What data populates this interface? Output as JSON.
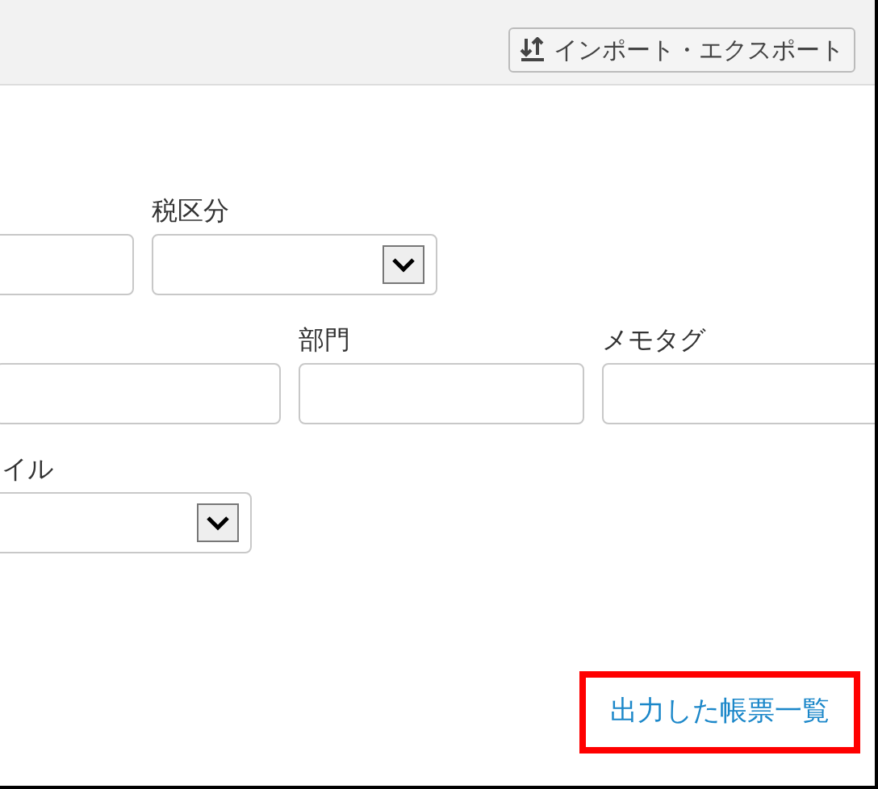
{
  "toolbar": {
    "button": "インポート・エクスポート"
  },
  "rows": [
    {
      "fields": [
        {
          "kind": "input"
        },
        {
          "kind": "select",
          "label": "税区分"
        }
      ]
    },
    {
      "fields": [
        {
          "kind": "input"
        },
        {
          "kind": "input",
          "label": "部門"
        },
        {
          "kind": "input",
          "label": "メモタグ"
        }
      ]
    },
    {
      "fields": [
        {
          "kind": "select",
          "label": "イル"
        }
      ]
    }
  ],
  "link": {
    "text": "出力した帳票一覧",
    "highlighted": true
  }
}
